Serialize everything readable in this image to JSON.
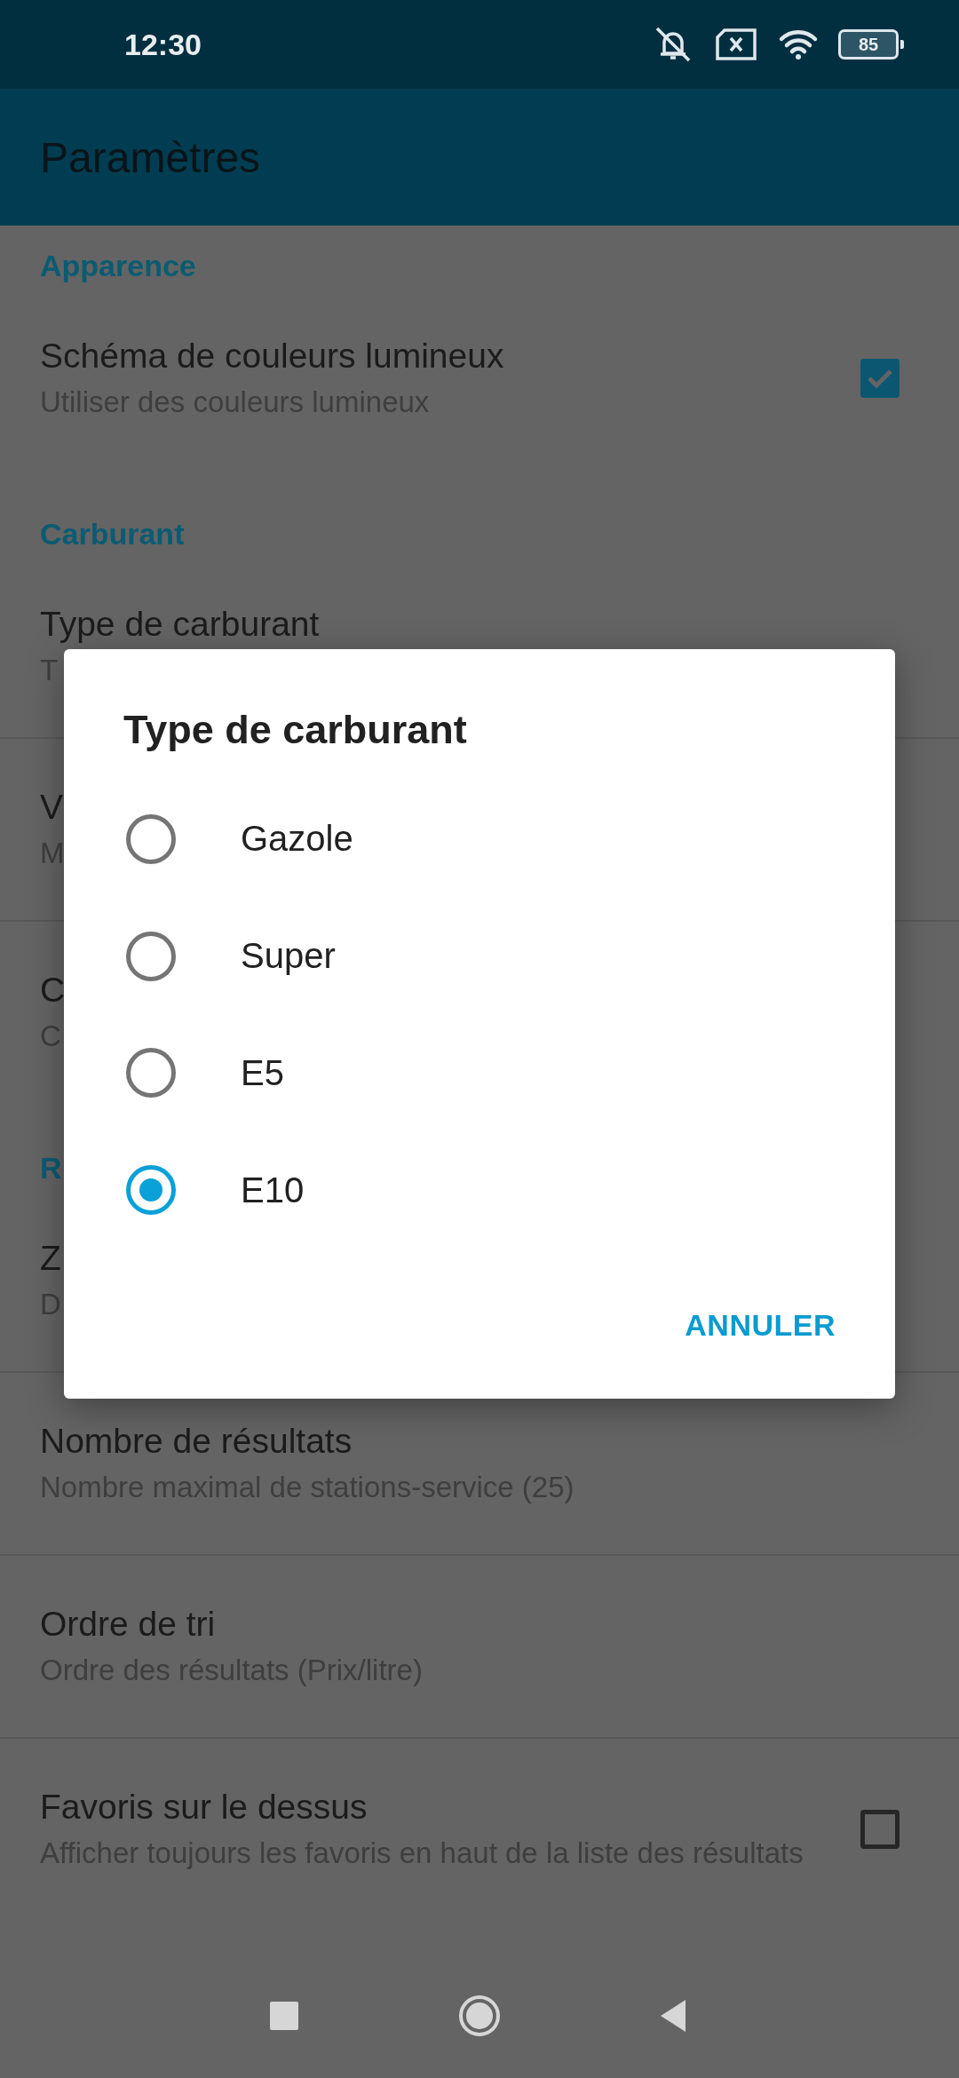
{
  "status_bar": {
    "time": "12:30",
    "battery": "85"
  },
  "app_bar": {
    "title": "Paramètres"
  },
  "sections": [
    {
      "header": "Apparence",
      "items": [
        {
          "title": "Schéma de couleurs lumineux",
          "summary": "Utiliser des couleurs lumineux",
          "kind": "checkbox",
          "checked": true
        }
      ]
    },
    {
      "header": "Carburant",
      "items": [
        {
          "title": "Type de carburant",
          "summary": "T",
          "kind": "plain"
        },
        {
          "title": "V",
          "summary": "M",
          "kind": "plain"
        },
        {
          "title": "C",
          "summary": "C",
          "kind": "plain"
        }
      ]
    },
    {
      "header": "R",
      "items": [
        {
          "title": "Z",
          "summary": "D",
          "kind": "plain"
        },
        {
          "title": "Nombre de résultats",
          "summary": "Nombre maximal de stations-service (25)",
          "kind": "plain"
        },
        {
          "title": "Ordre de tri",
          "summary": "Ordre des résultats (Prix/litre)",
          "kind": "plain"
        },
        {
          "title": "Favoris sur le dessus",
          "summary": "Afficher toujours les favoris en haut de la liste des résultats",
          "kind": "checkbox",
          "checked": false
        }
      ]
    }
  ],
  "dialog": {
    "title": "Type de carburant",
    "options": [
      {
        "label": "Gazole",
        "selected": false
      },
      {
        "label": "Super",
        "selected": false
      },
      {
        "label": "E5",
        "selected": false
      },
      {
        "label": "E10",
        "selected": true
      }
    ],
    "buttons": [
      "ANNULER"
    ]
  }
}
